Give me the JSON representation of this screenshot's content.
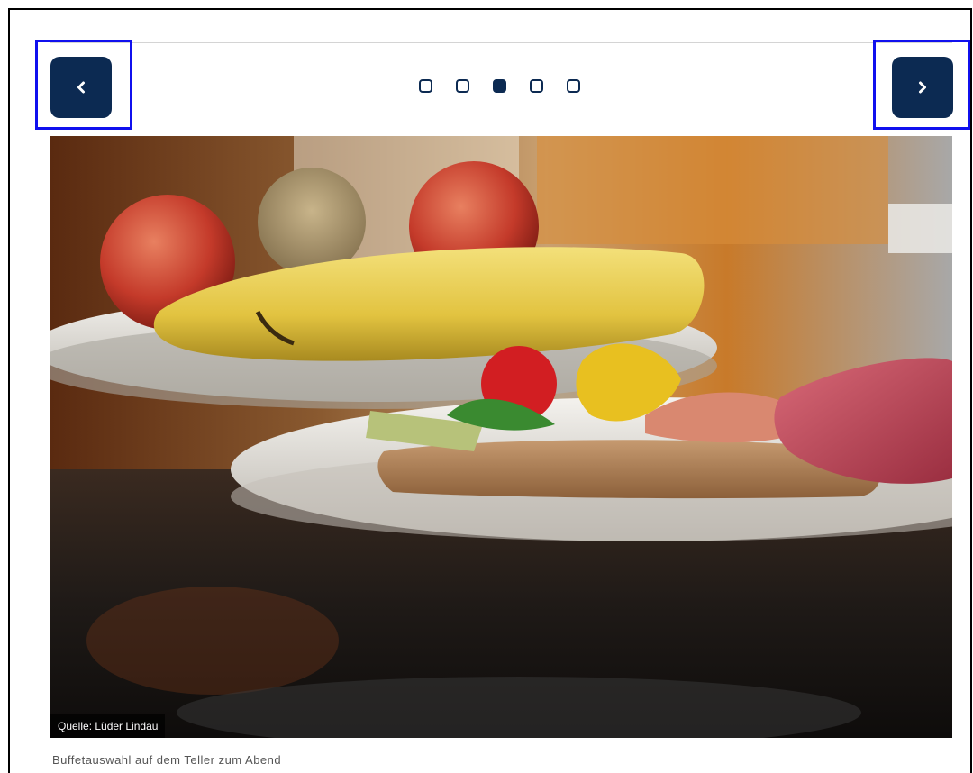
{
  "carousel": {
    "prev_button": {
      "icon": "chevron-left-icon"
    },
    "next_button": {
      "icon": "chevron-right-icon"
    },
    "dots": {
      "count": 5,
      "active_index": 2
    },
    "slide": {
      "image": "buffet-plate-photo",
      "credit": "Quelle: Lüder Lindau",
      "caption": "Buffetauswahl auf dem Teller zum Abend"
    }
  },
  "colors": {
    "accent": "#0c2a52",
    "highlight": "#1010ee"
  }
}
